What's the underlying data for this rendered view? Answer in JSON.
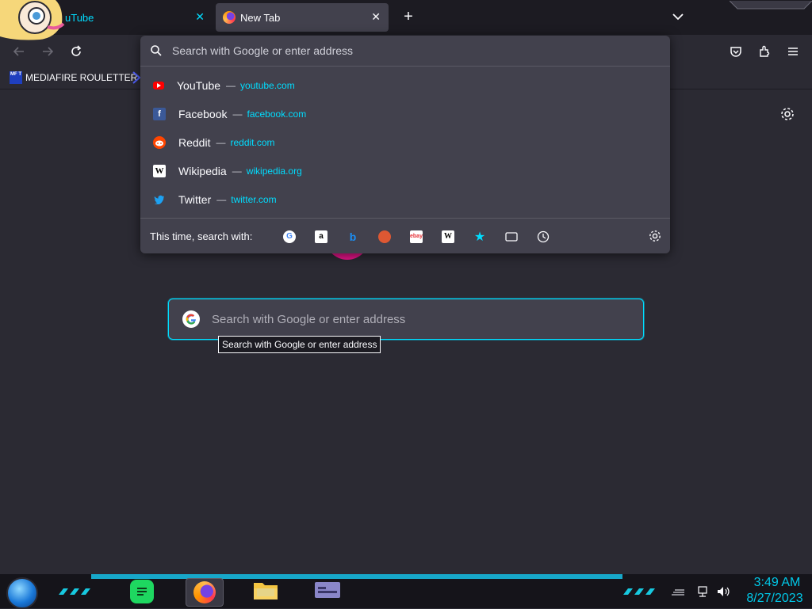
{
  "tabs": [
    {
      "label": "uTube",
      "active": false
    },
    {
      "label": "New Tab",
      "active": true
    }
  ],
  "bookmarks": [
    {
      "label": "MEDIAFIRE ROULETTER",
      "icon_text": "MF T"
    }
  ],
  "urlbar": {
    "placeholder": "Search with Google or enter address"
  },
  "suggestions": [
    {
      "title": "YouTube",
      "separator": "—",
      "url": "youtube.com",
      "icon": "youtube-icon"
    },
    {
      "title": "Facebook",
      "separator": "—",
      "url": "facebook.com",
      "icon": "facebook-icon"
    },
    {
      "title": "Reddit",
      "separator": "—",
      "url": "reddit.com",
      "icon": "reddit-icon"
    },
    {
      "title": "Wikipedia",
      "separator": "—",
      "url": "wikipedia.org",
      "icon": "wikipedia-icon"
    },
    {
      "title": "Twitter",
      "separator": "—",
      "url": "twitter.com",
      "icon": "twitter-icon"
    }
  ],
  "oneoff": {
    "label": "This time, search with:",
    "engines": [
      "google-icon",
      "amazon-icon",
      "bing-icon",
      "duckduckgo-icon",
      "ebay-icon",
      "wikipedia-icon",
      "bookmarks-star-icon",
      "tabs-icon",
      "history-icon"
    ]
  },
  "main_search": {
    "placeholder": "Search with Google or enter address",
    "tooltip": "Search with Google or enter address"
  },
  "taskbar": {
    "time": "3:49 AM",
    "date": "8/27/2023"
  },
  "colors": {
    "accent": "#00ddff",
    "background": "#2b2a33",
    "popup": "#42414d"
  }
}
